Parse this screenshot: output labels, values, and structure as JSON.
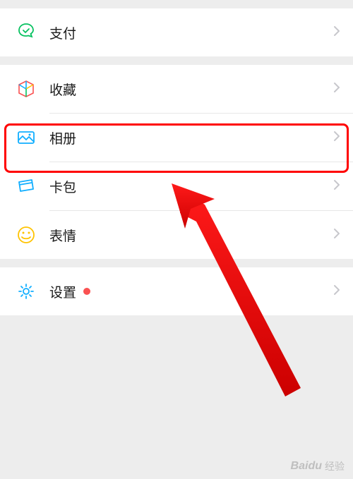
{
  "menu": {
    "payment": {
      "label": "支付",
      "icon": "payment-icon"
    },
    "favorites": {
      "label": "收藏",
      "icon": "favorites-icon"
    },
    "album": {
      "label": "相册",
      "icon": "album-icon"
    },
    "cards": {
      "label": "卡包",
      "icon": "cards-icon"
    },
    "emoji": {
      "label": "表情",
      "icon": "emoji-icon"
    },
    "settings": {
      "label": "设置",
      "icon": "settings-icon",
      "has_dot": true
    }
  },
  "annotation": {
    "highlighted_item": "album",
    "arrow_target": "album"
  },
  "watermark": {
    "brand": "Baidu",
    "text": "经验"
  }
}
